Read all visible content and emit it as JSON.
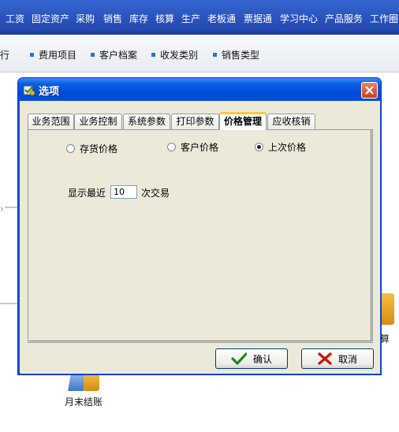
{
  "top_menu": {
    "items": [
      "工资",
      "固定资产",
      "采购",
      "销售",
      "库存",
      "核算",
      "生产",
      "老板通",
      "票据通",
      "学习中心",
      "产品服务",
      "工作圈"
    ]
  },
  "sub_menu": {
    "partial": "银行",
    "items": [
      "费用项目",
      "客户档案",
      "收发类别",
      "销售类型"
    ]
  },
  "background": {
    "partial_right_label": "算",
    "bottom_icon_label": "月末结账"
  },
  "dialog": {
    "title": "选项",
    "tabs": [
      "业务范围",
      "业务控制",
      "系统参数",
      "打印参数",
      "价格管理",
      "应收核销"
    ],
    "active_tab_index": 4,
    "price_options": [
      {
        "label": "存货价格",
        "checked": false
      },
      {
        "label": "客户价格",
        "checked": false
      },
      {
        "label": "上次价格",
        "checked": true
      }
    ],
    "recent": {
      "prefix": "显示最近",
      "value": "10",
      "suffix": "次交易"
    },
    "buttons": {
      "ok": "确认",
      "cancel": "取消"
    }
  },
  "colors": {
    "title_bar": "#0a5ee4",
    "dialog_bg": "#ece9d8",
    "menu_bar": "#2a52be",
    "active_tab_accent": "#ffc83c"
  }
}
